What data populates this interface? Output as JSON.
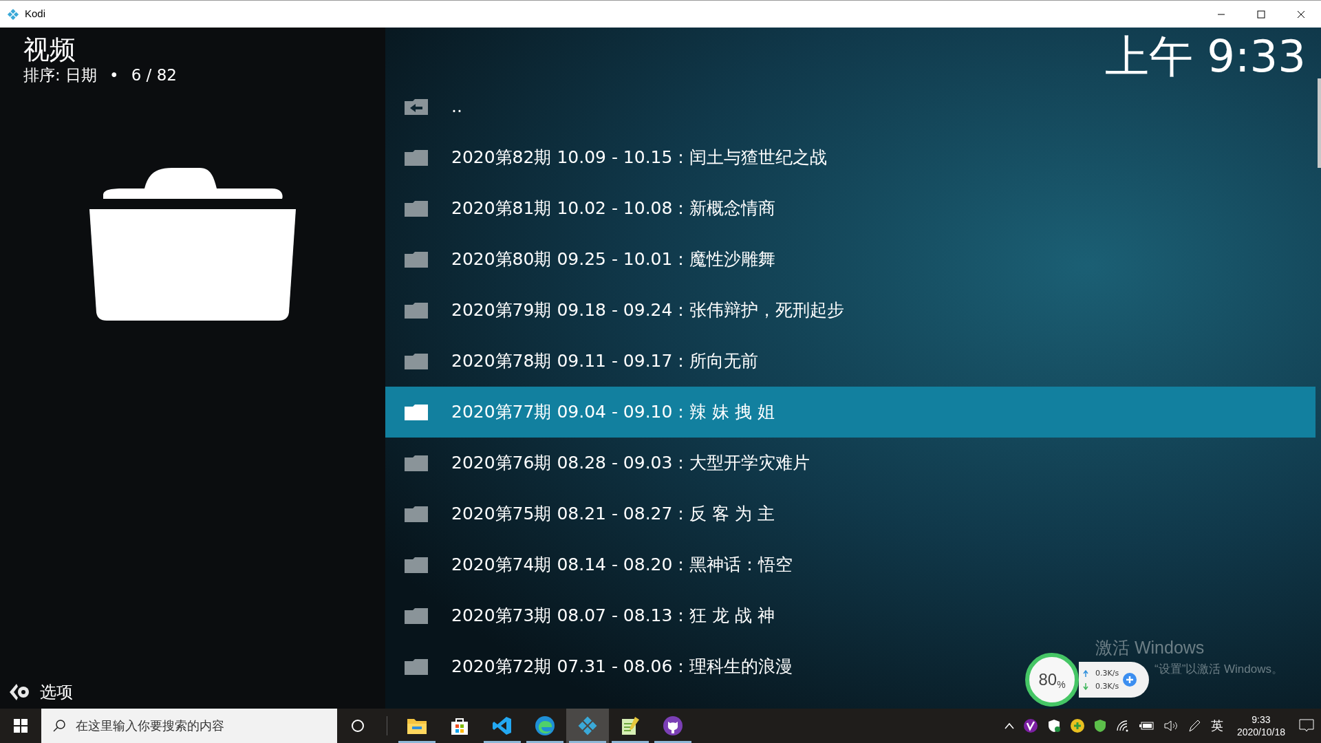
{
  "window": {
    "title": "Kodi"
  },
  "header": {
    "title": "视频",
    "sort": "排序: 日期",
    "separator": "•",
    "position": "6 / 82"
  },
  "clock": "上午 9:33",
  "list": {
    "items": [
      {
        "label": "..",
        "kind": "parent",
        "selected": false
      },
      {
        "label": "2020第82期 10.09 - 10.15：闰土与猹世纪之战",
        "kind": "folder",
        "selected": false
      },
      {
        "label": "2020第81期 10.02 - 10.08：新概念情商",
        "kind": "folder",
        "selected": false
      },
      {
        "label": "2020第80期 09.25 - 10.01：魔性沙雕舞",
        "kind": "folder",
        "selected": false
      },
      {
        "label": "2020第79期 09.18 - 09.24：张伟辩护，死刑起步",
        "kind": "folder",
        "selected": false
      },
      {
        "label": "2020第78期 09.11 - 09.17：所向无前",
        "kind": "folder",
        "selected": false
      },
      {
        "label": "2020第77期 09.04 - 09.10：辣 妹 拽 姐",
        "kind": "folder",
        "selected": true
      },
      {
        "label": "2020第76期 08.28 - 09.03：大型开学灾难片",
        "kind": "folder",
        "selected": false
      },
      {
        "label": "2020第75期 08.21 - 08.27：反 客 为 主",
        "kind": "folder",
        "selected": false
      },
      {
        "label": "2020第74期 08.14 - 08.20：黑神话：悟空",
        "kind": "folder",
        "selected": false
      },
      {
        "label": "2020第73期 08.07 - 08.13：狂 龙 战 神",
        "kind": "folder",
        "selected": false
      },
      {
        "label": "2020第72期 07.31 - 08.06：理科生的浪漫",
        "kind": "folder",
        "selected": false
      }
    ]
  },
  "options_button": "选项",
  "activation_notice": {
    "title": "激活 Windows",
    "subtitle": "“设置”以激活 Windows。"
  },
  "speed_widget": {
    "percent": "80",
    "unit": "%",
    "upload": "0.3K/s",
    "download": "0.3K/s"
  },
  "taskbar": {
    "search_placeholder": "在这里输入你要搜索的内容",
    "apps": [
      {
        "kind": "explorer",
        "running": true,
        "selected": false
      },
      {
        "kind": "store",
        "running": false,
        "selected": false
      },
      {
        "kind": "vscode",
        "running": true,
        "selected": false
      },
      {
        "kind": "edge",
        "running": true,
        "selected": false
      },
      {
        "kind": "kodi",
        "running": true,
        "selected": true
      },
      {
        "kind": "notepad",
        "running": true,
        "selected": false
      },
      {
        "kind": "github",
        "running": true,
        "selected": false
      }
    ],
    "language": "英",
    "time": "9:33",
    "date": "2020/10/18"
  }
}
